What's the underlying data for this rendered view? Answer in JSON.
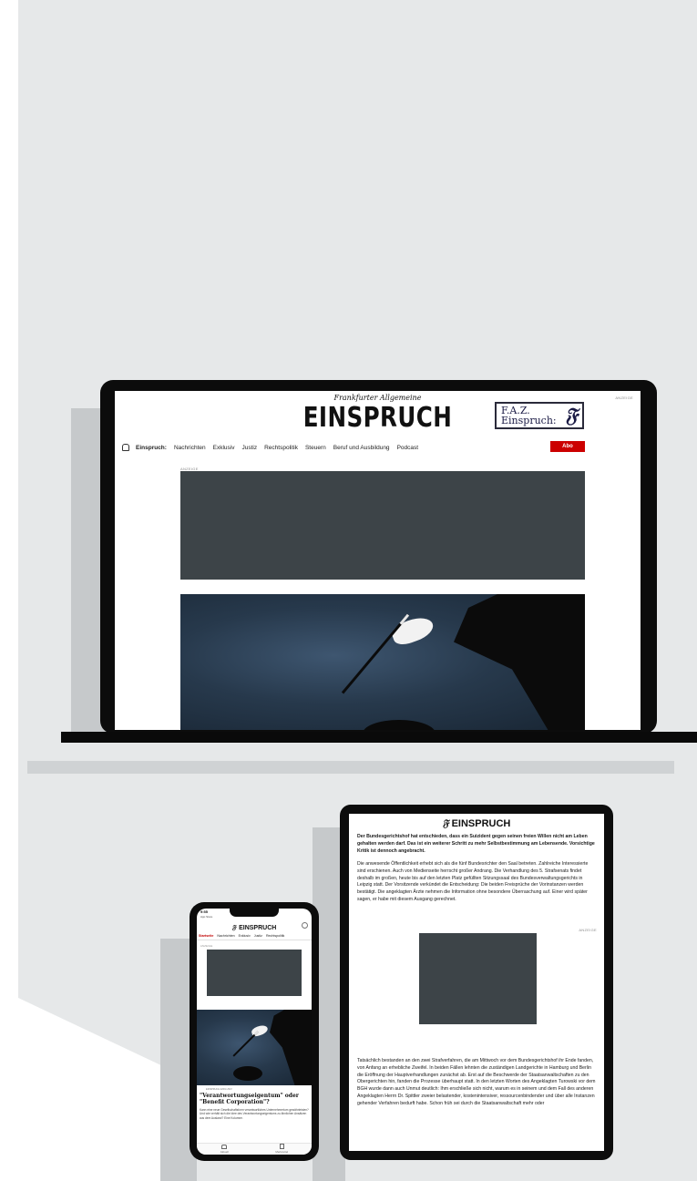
{
  "laptop": {
    "masthead_small": "Frankfurter Allgemeine",
    "brand": "EINSPRUCH",
    "ad_label_top": "ANZEIGE",
    "ad_label_main": "ANZEIGE",
    "faz_box": {
      "line1": "F.A.Z.",
      "line2": "Einspruch:",
      "logo": "𝔉"
    },
    "nav": {
      "home_icon": "home-icon",
      "items": [
        {
          "label": "Einspruch:",
          "active": true
        },
        {
          "label": "Nachrichten"
        },
        {
          "label": "Exklusiv"
        },
        {
          "label": "Justiz"
        },
        {
          "label": "Rechtspolitik"
        },
        {
          "label": "Steuern"
        },
        {
          "label": "Beruf und Ausbildung"
        },
        {
          "label": "Podcast"
        }
      ],
      "abo_label": "Abo"
    }
  },
  "tablet": {
    "brand_logo": "𝔉",
    "brand": "EINSPRUCH",
    "lead": "Der Bundesgerichtshof hat entschieden, dass ein Suizident gegen seinen freien Willen nicht am Leben gehalten werden darf. Das ist ein weiterer Schritt zu mehr Selbstbe­stimmung am Lebensende. Vorsichtige Kritik ist dennoch angebracht.",
    "para1": "Die anwesende Öffentlichkeit erhebt sich als die fünf Bundesrichter den Saal betreten. Zahlreiche Interessierte sind erschienen. Auch von Medienseite herrscht großer Andrang. Die Verhandlung des 5. Strafsenats findet deshalb im großen, heute bis auf den letzten Platz gefüllten Sitzungssaal des Bundesverwaltungsgerichts in Leipzig statt. Der Vorsitzende verkündet die Entscheidung: Die beiden Freisprüche der Vorinstanzen werden bestätigt. Die angeklagten Ärzte nehmen die Information ohne besondere Überraschung auf. Einer wird später sagen, er habe mit diesem Ausgang gerechnet.",
    "ad_label": "ANZEIGE",
    "para2": "Tatsächlich bestanden an den zwei Strafverfahren, die am Mittwoch vor dem Bundesgerichtshof ihr Ende fanden, von Anfang an erhebliche Zweifel. In beiden Fällen lehnten die zuständigen Landgerichte in Hamburg und Berlin die Eröffnung der Hauptverhandlungen zunächst ab. Erst auf die Beschwerde der Staatsanwaltschaften zu den Obergerichten hin, fanden die Prozesse überhaupt statt. In den letzten Worten des Angeklagten Turowski vor dem BGH wurde dann auch Unmut deutlich: Ihm erschließe sich nicht, warum es in seinem und dem Fall des anderen Angeklagten Herrn Dr. Spittler zweier belastender, kostenintensiver, ressourcenbindender und über alle Instanzen gehender Verfahren bedurft habe. Schon früh sei durch die Staatsanwaltschaft mehr oder"
  },
  "phone": {
    "time": "9:55",
    "back_label": "App Store",
    "brand_logo": "𝔉",
    "brand": "EINSPRUCH",
    "tabs": [
      {
        "label": "Startseite",
        "active": true
      },
      {
        "label": "Nachrichten"
      },
      {
        "label": "Exklusiv"
      },
      {
        "label": "Justiz"
      },
      {
        "label": "Rechtspolitik"
      }
    ],
    "ad_label": "ANZEIGE",
    "kicker": "EINSPRUCH EXKLUSIV",
    "headline": "\"Verantwortungseigentum\" oder \"Benefit Corporation\"?",
    "teaser": "Kann eine neue Gesellschaftsform verantwortliches Unternehmertum gewährleisten? Und wie verhält sich die Idee des Verantwortungseigentums zu ähnlichen Ansätzen aus dem Ausland? Eine Kolumne.",
    "tabbar": [
      {
        "label": "Aktuell"
      },
      {
        "label": "Merkzettel"
      }
    ]
  }
}
